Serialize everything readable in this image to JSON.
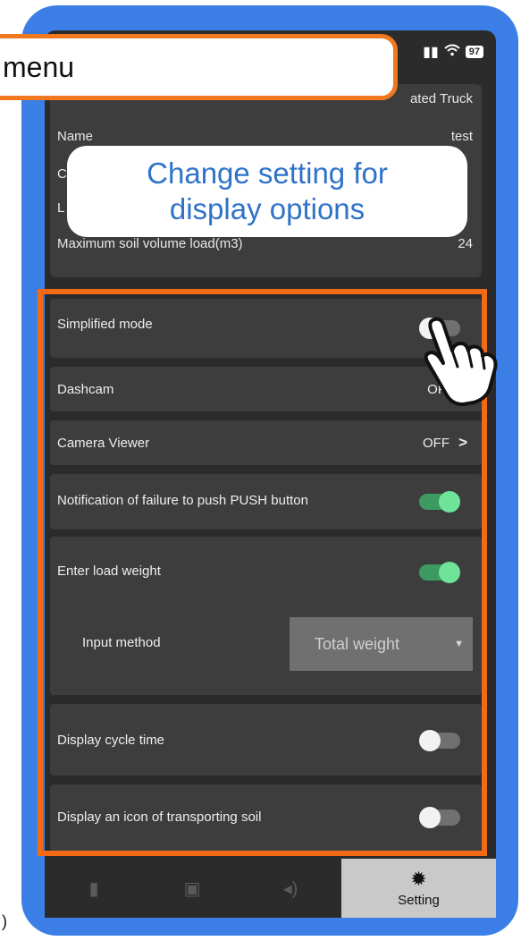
{
  "status_bar": {
    "signal": "▐▌",
    "wifi": "◠",
    "battery": "97"
  },
  "info": {
    "type_value": "ated Truck",
    "name_label": "Name",
    "name_value": "test",
    "row2_label": "C",
    "row3_label": "L",
    "max_soil_label": "Maximum soil volume load(m3)",
    "max_soil_value": "24"
  },
  "settings": {
    "simplified_mode": {
      "label": "Simplified mode",
      "on": false
    },
    "dashcam": {
      "label": "Dashcam",
      "value": "OF"
    },
    "camera_viewer": {
      "label": "Camera Viewer",
      "value": "OFF",
      "chevron": ">"
    },
    "push_notification": {
      "label": "Notification of failure to push PUSH button",
      "on": true
    },
    "enter_load_weight": {
      "label": "Enter load weight",
      "on": true
    },
    "input_method": {
      "label": "Input method",
      "selected": "Total weight"
    },
    "display_cycle_time": {
      "label": "Display cycle time",
      "on": false
    },
    "display_soil_icon": {
      "label": "Display an icon of transporting soil",
      "on": false
    }
  },
  "tabbar": {
    "active_label": "Setting"
  },
  "annotations": {
    "menu_callout": "menu",
    "bubble_line1": "Change setting for",
    "bubble_line2": "display options",
    "edge_char": ")"
  },
  "colors": {
    "frame": "#3b7fe6",
    "highlight": "#f26a16",
    "toggle_on": "#6fe39a",
    "bubble_text": "#2f73c9"
  }
}
